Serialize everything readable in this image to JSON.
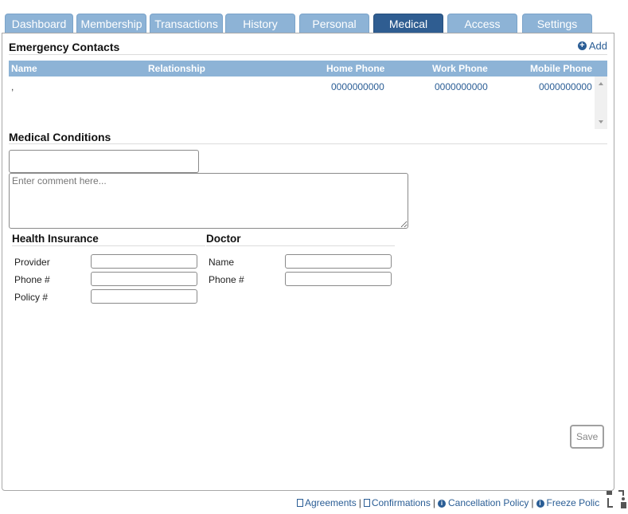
{
  "tabs": [
    {
      "label": "Dashboard",
      "active": false
    },
    {
      "label": "Membership",
      "active": false
    },
    {
      "label": "Transactions",
      "active": false
    },
    {
      "label": "History",
      "active": false
    },
    {
      "label": "Personal",
      "active": false
    },
    {
      "label": "Medical",
      "active": true
    },
    {
      "label": "Access",
      "active": false
    },
    {
      "label": "Settings",
      "active": false
    }
  ],
  "emergency": {
    "title": "Emergency Contacts",
    "add_label": "Add",
    "columns": [
      "Name",
      "Relationship",
      "Home Phone",
      "Work Phone",
      "Mobile Phone"
    ],
    "rows": [
      {
        "name": ",",
        "relationship": "",
        "home": "0000000000",
        "work": "0000000000",
        "mobile": "0000000000"
      }
    ]
  },
  "medical": {
    "title": "Medical Conditions",
    "condition_value": "",
    "comment_placeholder": "Enter comment here..."
  },
  "insurance": {
    "title": "Health Insurance",
    "provider_label": "Provider",
    "phone_label": "Phone #",
    "policy_label": "Policy #"
  },
  "doctor": {
    "title": "Doctor",
    "name_label": "Name",
    "phone_label": "Phone #"
  },
  "save_label": "Save",
  "footer": {
    "agreements": "Agreements",
    "confirmations": "Confirmations",
    "cancellation": "Cancellation Policy",
    "freeze": "Freeze Polic",
    "separator": "|"
  },
  "colors": {
    "tab": "#8db3d6",
    "tab_active": "#2f5d91",
    "link": "#2a5d95"
  }
}
